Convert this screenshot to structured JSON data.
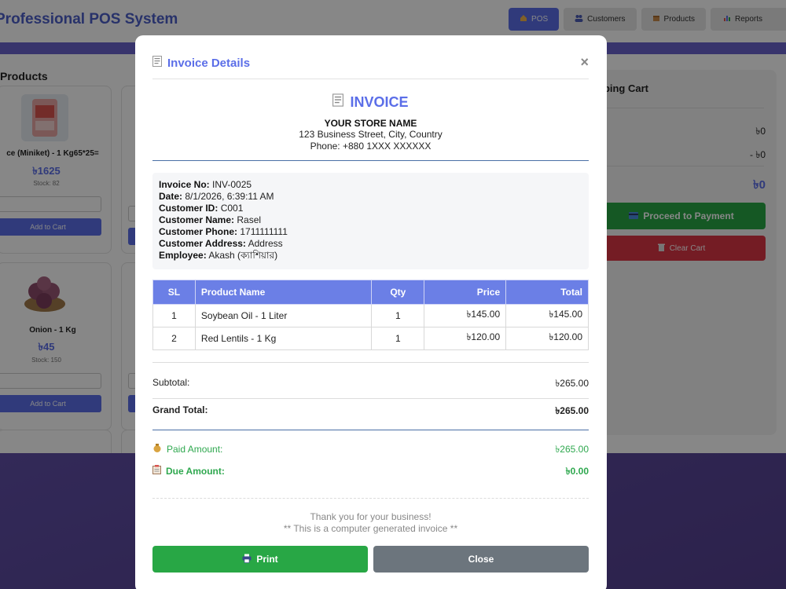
{
  "app": {
    "title": "Professional POS System"
  },
  "nav": [
    {
      "label": "POS",
      "icon": "house-icon"
    },
    {
      "label": "Customers",
      "icon": "people-icon"
    },
    {
      "label": "Products",
      "icon": "box-icon"
    },
    {
      "label": "Reports",
      "icon": "bar-chart-icon"
    }
  ],
  "products_title": "Products",
  "products": [
    {
      "name": "ce (Miniket) - 1 Kg65*25=",
      "price": "৳1625",
      "stock": "Stock: 82",
      "add_label": "Add to Cart"
    },
    {
      "name": "Onion - 1 Kg",
      "price": "৳45",
      "stock": "Stock: 150",
      "add_label": "Add to Cart"
    }
  ],
  "cart": {
    "title": "pping Cart",
    "line1": "৳0",
    "line2": "- ৳0",
    "total": "৳0",
    "pay_label": "Proceed to Payment",
    "clear_label": "Clear Cart"
  },
  "modal": {
    "title": "Invoice Details",
    "close_symbol": "×",
    "invoice_title": "INVOICE",
    "store_name": "YOUR STORE NAME",
    "store_address": "123 Business Street, City, Country",
    "store_phone": "Phone: +880 1XXX XXXXXX",
    "info": {
      "invoice_no_label": "Invoice No:",
      "invoice_no": "INV-0025",
      "date_label": "Date:",
      "date": "8/1/2026, 6:39:11 AM",
      "customer_id_label": "Customer ID:",
      "customer_id": "C001",
      "customer_name_label": "Customer Name:",
      "customer_name": "Rasel",
      "customer_phone_label": "Customer Phone:",
      "customer_phone": "1711111111",
      "customer_address_label": "Customer Address:",
      "customer_address": "Address",
      "employee_label": "Employee:",
      "employee": "Akash (ক্যাশিয়ার)"
    },
    "table": {
      "headers": {
        "sl": "SL",
        "product": "Product Name",
        "qty": "Qty",
        "price": "Price",
        "total": "Total"
      },
      "rows": [
        {
          "sl": "1",
          "product": "Soybean Oil - 1 Liter",
          "qty": "1",
          "price": "৳145.00",
          "total": "৳145.00"
        },
        {
          "sl": "2",
          "product": "Red Lentils - 1 Kg",
          "qty": "1",
          "price": "৳120.00",
          "total": "৳120.00"
        }
      ]
    },
    "summary": {
      "subtotal_label": "Subtotal:",
      "subtotal": "৳265.00",
      "grand_total_label": "Grand Total:",
      "grand_total": "৳265.00",
      "paid_label": "Paid Amount:",
      "paid": "৳265.00",
      "due_label": "Due Amount:",
      "due": "৳0.00"
    },
    "thanks_line1": "Thank you for your business!",
    "thanks_line2": "** This is a computer generated invoice **",
    "print_label": "Print",
    "close_label": "Close"
  },
  "colors": {
    "accent": "#5b6ee8",
    "table_header": "#6b7fe6",
    "success": "#28a745",
    "danger": "#dc3545",
    "secondary": "#6c757d"
  }
}
